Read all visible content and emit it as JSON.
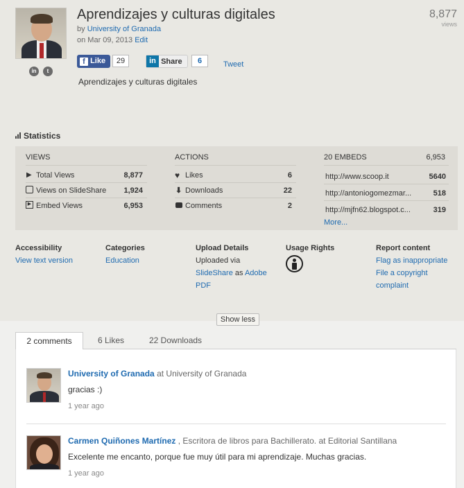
{
  "header": {
    "title": "Aprendizajes y culturas digitales",
    "by_prefix": "by",
    "author": "University of Granada",
    "date": "on Mar 09, 2013",
    "edit_label": "Edit",
    "views_count": "8,877",
    "views_label": "views",
    "description": "Aprendizajes y culturas digitales"
  },
  "social": {
    "fb_label": "Like",
    "fb_count": "29",
    "li_label": "Share",
    "li_count": "6",
    "tweet_label": "Tweet"
  },
  "statistics": {
    "heading": "Statistics",
    "views": {
      "header": "VIEWS",
      "rows": [
        {
          "label": "Total Views",
          "value": "8,877",
          "icon": "play-icon"
        },
        {
          "label": "Views on SlideShare",
          "value": "1,924",
          "icon": "slideshare-icon"
        },
        {
          "label": "Embed Views",
          "value": "6,953",
          "icon": "embed-icon"
        }
      ]
    },
    "actions": {
      "header": "ACTIONS",
      "rows": [
        {
          "label": "Likes",
          "value": "6",
          "icon": "heart-icon"
        },
        {
          "label": "Downloads",
          "value": "22",
          "icon": "download-icon"
        },
        {
          "label": "Comments",
          "value": "2",
          "icon": "comment-icon"
        }
      ]
    },
    "embeds": {
      "header": "20 EMBEDS",
      "total": "6,953",
      "rows": [
        {
          "url": "http://www.scoop.it",
          "value": "5640"
        },
        {
          "url": "http://antoniogomezmar...",
          "value": "518"
        },
        {
          "url": "http://mjfn62.blogspot.c...",
          "value": "319"
        }
      ],
      "more_label": "More..."
    }
  },
  "details": {
    "accessibility": {
      "heading": "Accessibility",
      "link": "View text version"
    },
    "categories": {
      "heading": "Categories",
      "link": "Education"
    },
    "upload": {
      "heading": "Upload Details",
      "text1": "Uploaded via",
      "link1": "SlideShare",
      "text2": "as",
      "link2": "Adobe",
      "link3": "PDF"
    },
    "usage": {
      "heading": "Usage Rights"
    },
    "report": {
      "heading": "Report content",
      "link1": "Flag as inappropriate",
      "link2": "File a copyright",
      "link3": "complaint"
    }
  },
  "show_less_label": "Show less",
  "tabs": [
    {
      "label": "2 comments"
    },
    {
      "label": "6 Likes"
    },
    {
      "label": "22 Downloads"
    }
  ],
  "comments": [
    {
      "name": "University of Granada",
      "org": "at University of Granada",
      "text": "gracias :)",
      "time": "1 year ago"
    },
    {
      "name": "Carmen Quiñones Martínez",
      "org": ", Escritora de libros para Bachillerato. at Editorial Santillana",
      "text": "Excelente me encanto, porque fue muy útil para mi aprendizaje. Muchas gracias.",
      "time": "1 year ago"
    }
  ],
  "colors": {
    "link": "#1e6ab0",
    "facebook": "#3b5998",
    "page_bg": "#e9e8e3"
  }
}
